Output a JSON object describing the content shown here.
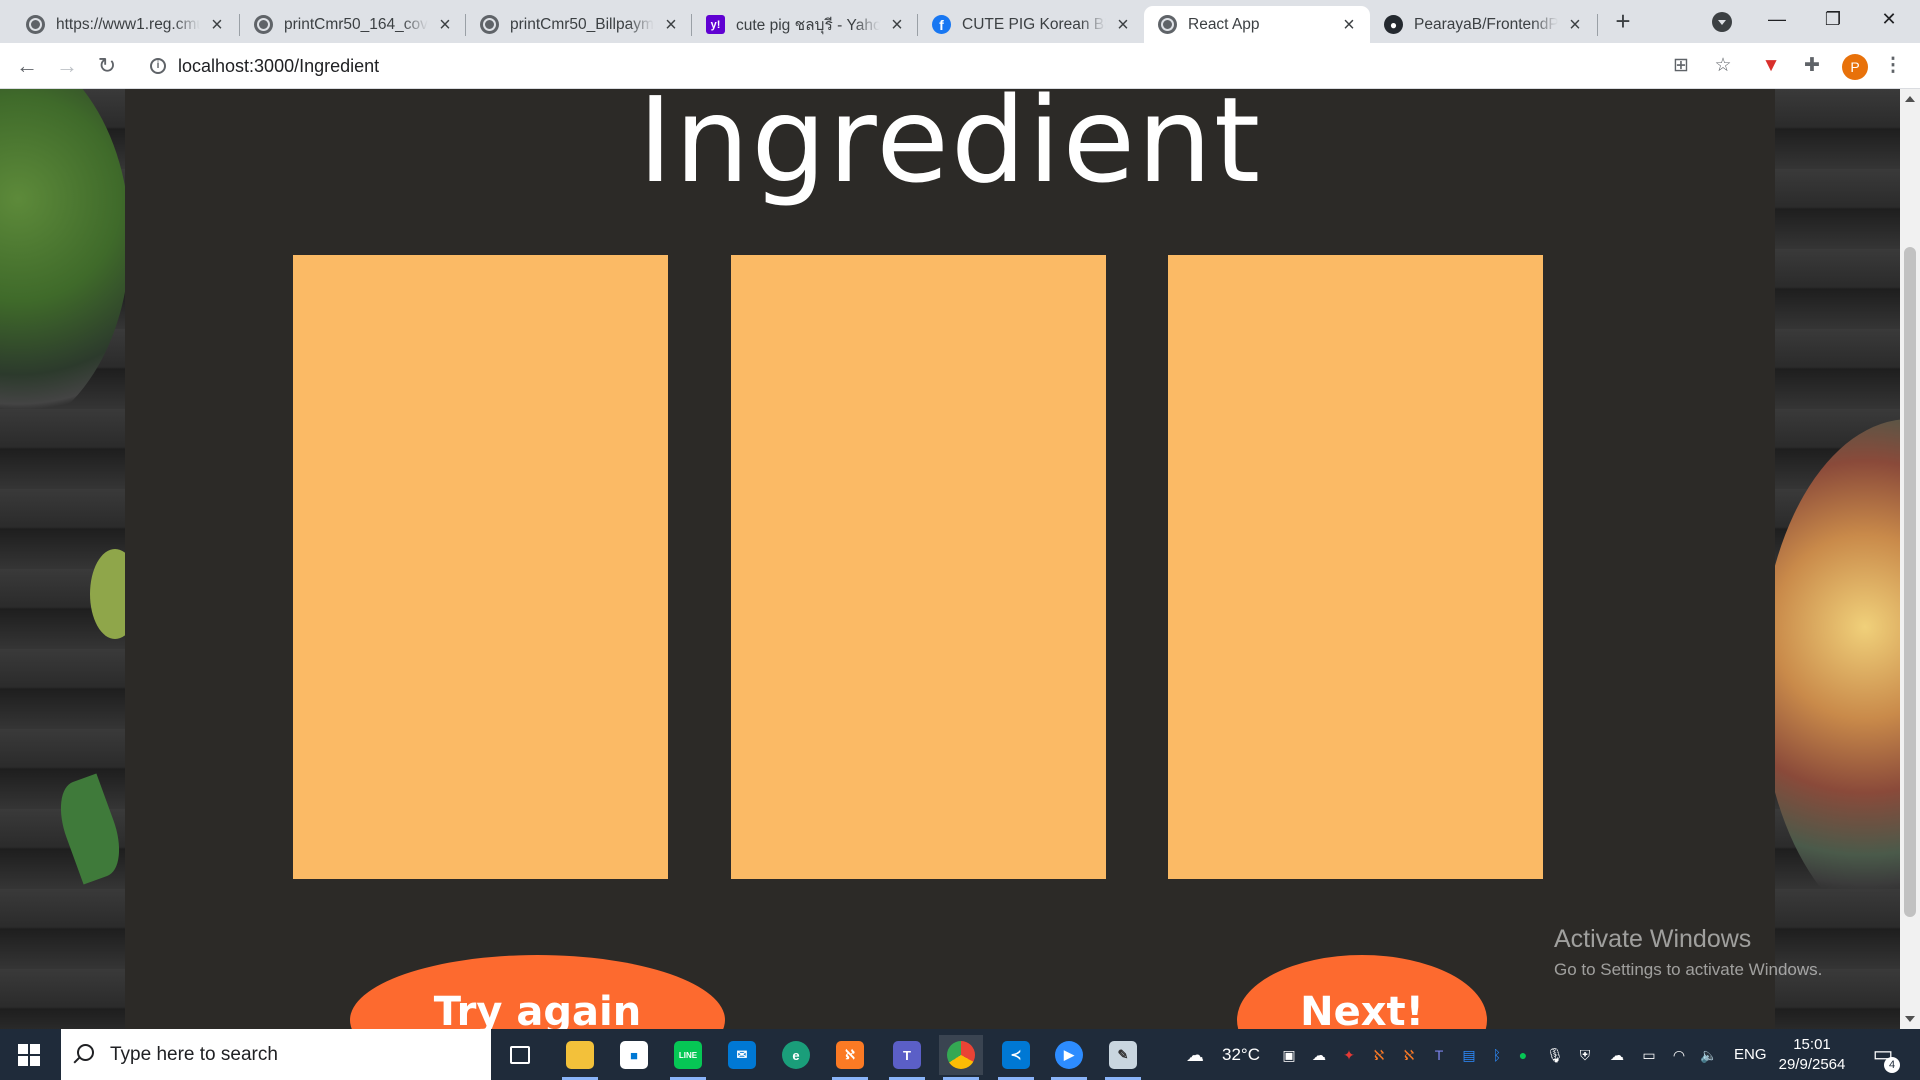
{
  "browser": {
    "tabs": [
      {
        "title": "https://www1.reg.cmu",
        "favicon": "globe-icon"
      },
      {
        "title": "printCmr50_164_covid",
        "favicon": "globe-icon"
      },
      {
        "title": "printCmr50_Billpayme",
        "favicon": "globe-icon"
      },
      {
        "title": "cute pig ชลบุรี - Yahoo",
        "favicon": "yahoo-icon"
      },
      {
        "title": "CUTE PIG Korean BBQ",
        "favicon": "facebook-icon"
      },
      {
        "title": "React App",
        "favicon": "globe-icon",
        "active": true
      },
      {
        "title": "PearayaB/FrontendPro",
        "favicon": "github-icon"
      }
    ],
    "new_tab": "+",
    "address": "localhost:3000/Ingredient",
    "profile_initial": "P",
    "window_controls": {
      "minimize": "—",
      "restore": "❐",
      "close": "✕"
    }
  },
  "page": {
    "heading": "Ingredient",
    "cards": [
      {
        "label": ""
      },
      {
        "label": ""
      },
      {
        "label": ""
      }
    ],
    "try_again_label": "Try again",
    "next_label": "Next!",
    "colors": {
      "panel": "#2c2a27",
      "card": "#fbba65",
      "button": "#fd6a2f"
    }
  },
  "watermark": {
    "title": "Activate Windows",
    "subtitle": "Go to Settings to activate Windows."
  },
  "taskbar": {
    "search_placeholder": "Type here to search",
    "weather": "32°C",
    "language": "ENG",
    "time": "15:01",
    "date": "29/9/2564",
    "notification_count": "4"
  }
}
